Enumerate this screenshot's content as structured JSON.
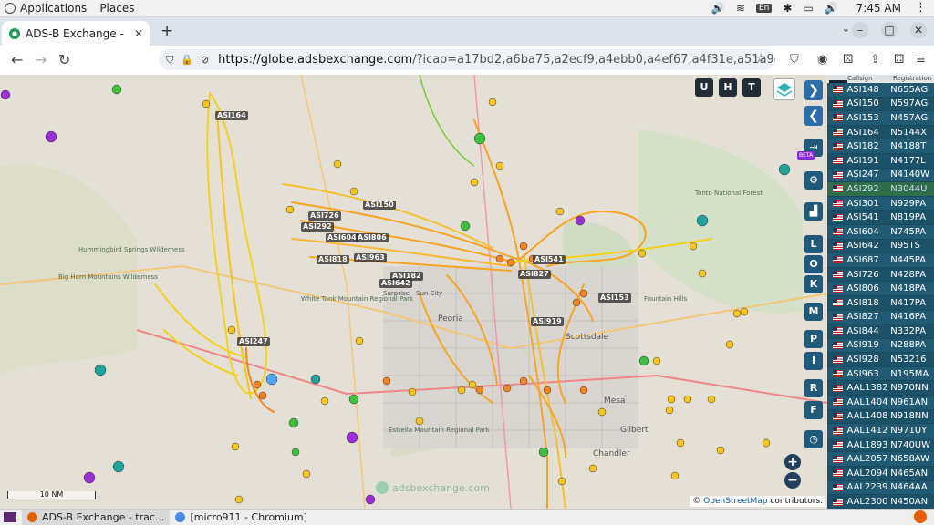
{
  "system_bar": {
    "applications": "Applications",
    "places": "Places",
    "lang": "En",
    "time": "7:45 AM"
  },
  "browser": {
    "tab_title": "ADS-B Exchange - track a",
    "new_tab": "+",
    "url_host": "https://globe.adsbexchange.com",
    "url_rest": "/?icao=a17bd2,a6ba75,a2ecf9,a4ebb0,a4ef67,a4f31e,a51a9d,ad3408,aa066"
  },
  "map": {
    "top_buttons": [
      "U",
      "H",
      "T"
    ],
    "side_letters": [
      "L",
      "O",
      "K",
      "M",
      "P",
      "I",
      "R",
      "F"
    ],
    "beta_badge": "BETA",
    "scale_label": "10 NM",
    "watermark": "adsbexchange.com",
    "attribution_prefix": "© ",
    "attribution_link": "OpenStreetMap",
    "attribution_suffix": " contributors.",
    "place_labels": [
      "Tonto National Forest",
      "Peoria",
      "Sun City",
      "Surprise",
      "Scottsdale",
      "Mesa",
      "Gilbert",
      "Chandler",
      "Fountain Hills",
      "White Tank Mountain Regional Park",
      "Hummingbird Springs Wilderness",
      "Big Horn Mountains Wilderness",
      "Estrella Mountain Regional Park"
    ],
    "callsigns": [
      {
        "label": "ASI164"
      },
      {
        "label": "ASI726"
      },
      {
        "label": "ASI150"
      },
      {
        "label": "ASI292"
      },
      {
        "label": "ASI604"
      },
      {
        "label": "ASI806"
      },
      {
        "label": "ASI818"
      },
      {
        "label": "ASI963"
      },
      {
        "label": "ASI182"
      },
      {
        "label": "ASI642"
      },
      {
        "label": "ASI541"
      },
      {
        "label": "ASI827"
      },
      {
        "label": "ASI153"
      },
      {
        "label": "ASI919"
      },
      {
        "label": "ASI247"
      }
    ],
    "colors": {
      "track_orange": "#f5a623",
      "track_yellow": "#f2d21b",
      "plane_yellow": "#f5c518",
      "plane_green": "#3fbf3f",
      "plane_purple": "#9b2fd6",
      "plane_teal": "#1fa39a"
    }
  },
  "panel": {
    "header_callsign": "Callsign",
    "header_registration": "Registration",
    "rows": [
      {
        "cs": "ASI148",
        "reg": "N655AG"
      },
      {
        "cs": "ASI150",
        "reg": "N597AG"
      },
      {
        "cs": "ASI153",
        "reg": "N457AG"
      },
      {
        "cs": "ASI164",
        "reg": "N5144X"
      },
      {
        "cs": "ASI182",
        "reg": "N4188T"
      },
      {
        "cs": "ASI191",
        "reg": "N4177L"
      },
      {
        "cs": "ASI247",
        "reg": "N4140W"
      },
      {
        "cs": "ASI292",
        "reg": "N3044U"
      },
      {
        "cs": "ASI301",
        "reg": "N929PA"
      },
      {
        "cs": "ASI541",
        "reg": "N819PA"
      },
      {
        "cs": "ASI604",
        "reg": "N745PA"
      },
      {
        "cs": "ASI642",
        "reg": "N95TS"
      },
      {
        "cs": "ASI687",
        "reg": "N445PA"
      },
      {
        "cs": "ASI726",
        "reg": "N428PA"
      },
      {
        "cs": "ASI806",
        "reg": "N418PA"
      },
      {
        "cs": "ASI818",
        "reg": "N417PA"
      },
      {
        "cs": "ASI827",
        "reg": "N416PA"
      },
      {
        "cs": "ASI844",
        "reg": "N332PA"
      },
      {
        "cs": "ASI919",
        "reg": "N288PA"
      },
      {
        "cs": "ASI928",
        "reg": "N53216"
      },
      {
        "cs": "ASI963",
        "reg": "N195MA"
      },
      {
        "cs": "AAL1382",
        "reg": "N970NN"
      },
      {
        "cs": "AAL1404",
        "reg": "N961AN"
      },
      {
        "cs": "AAL1408",
        "reg": "N918NN"
      },
      {
        "cs": "AAL1412",
        "reg": "N971UY"
      },
      {
        "cs": "AAL1893",
        "reg": "N740UW"
      },
      {
        "cs": "AAL2057",
        "reg": "N658AW"
      },
      {
        "cs": "AAL2094",
        "reg": "N465AN"
      },
      {
        "cs": "AAL2239",
        "reg": "N464AA"
      },
      {
        "cs": "AAL2300",
        "reg": "N450AN"
      }
    ]
  },
  "taskbar": {
    "items": [
      "ADS-B Exchange - trac...",
      "[micro911 - Chromium]"
    ]
  }
}
